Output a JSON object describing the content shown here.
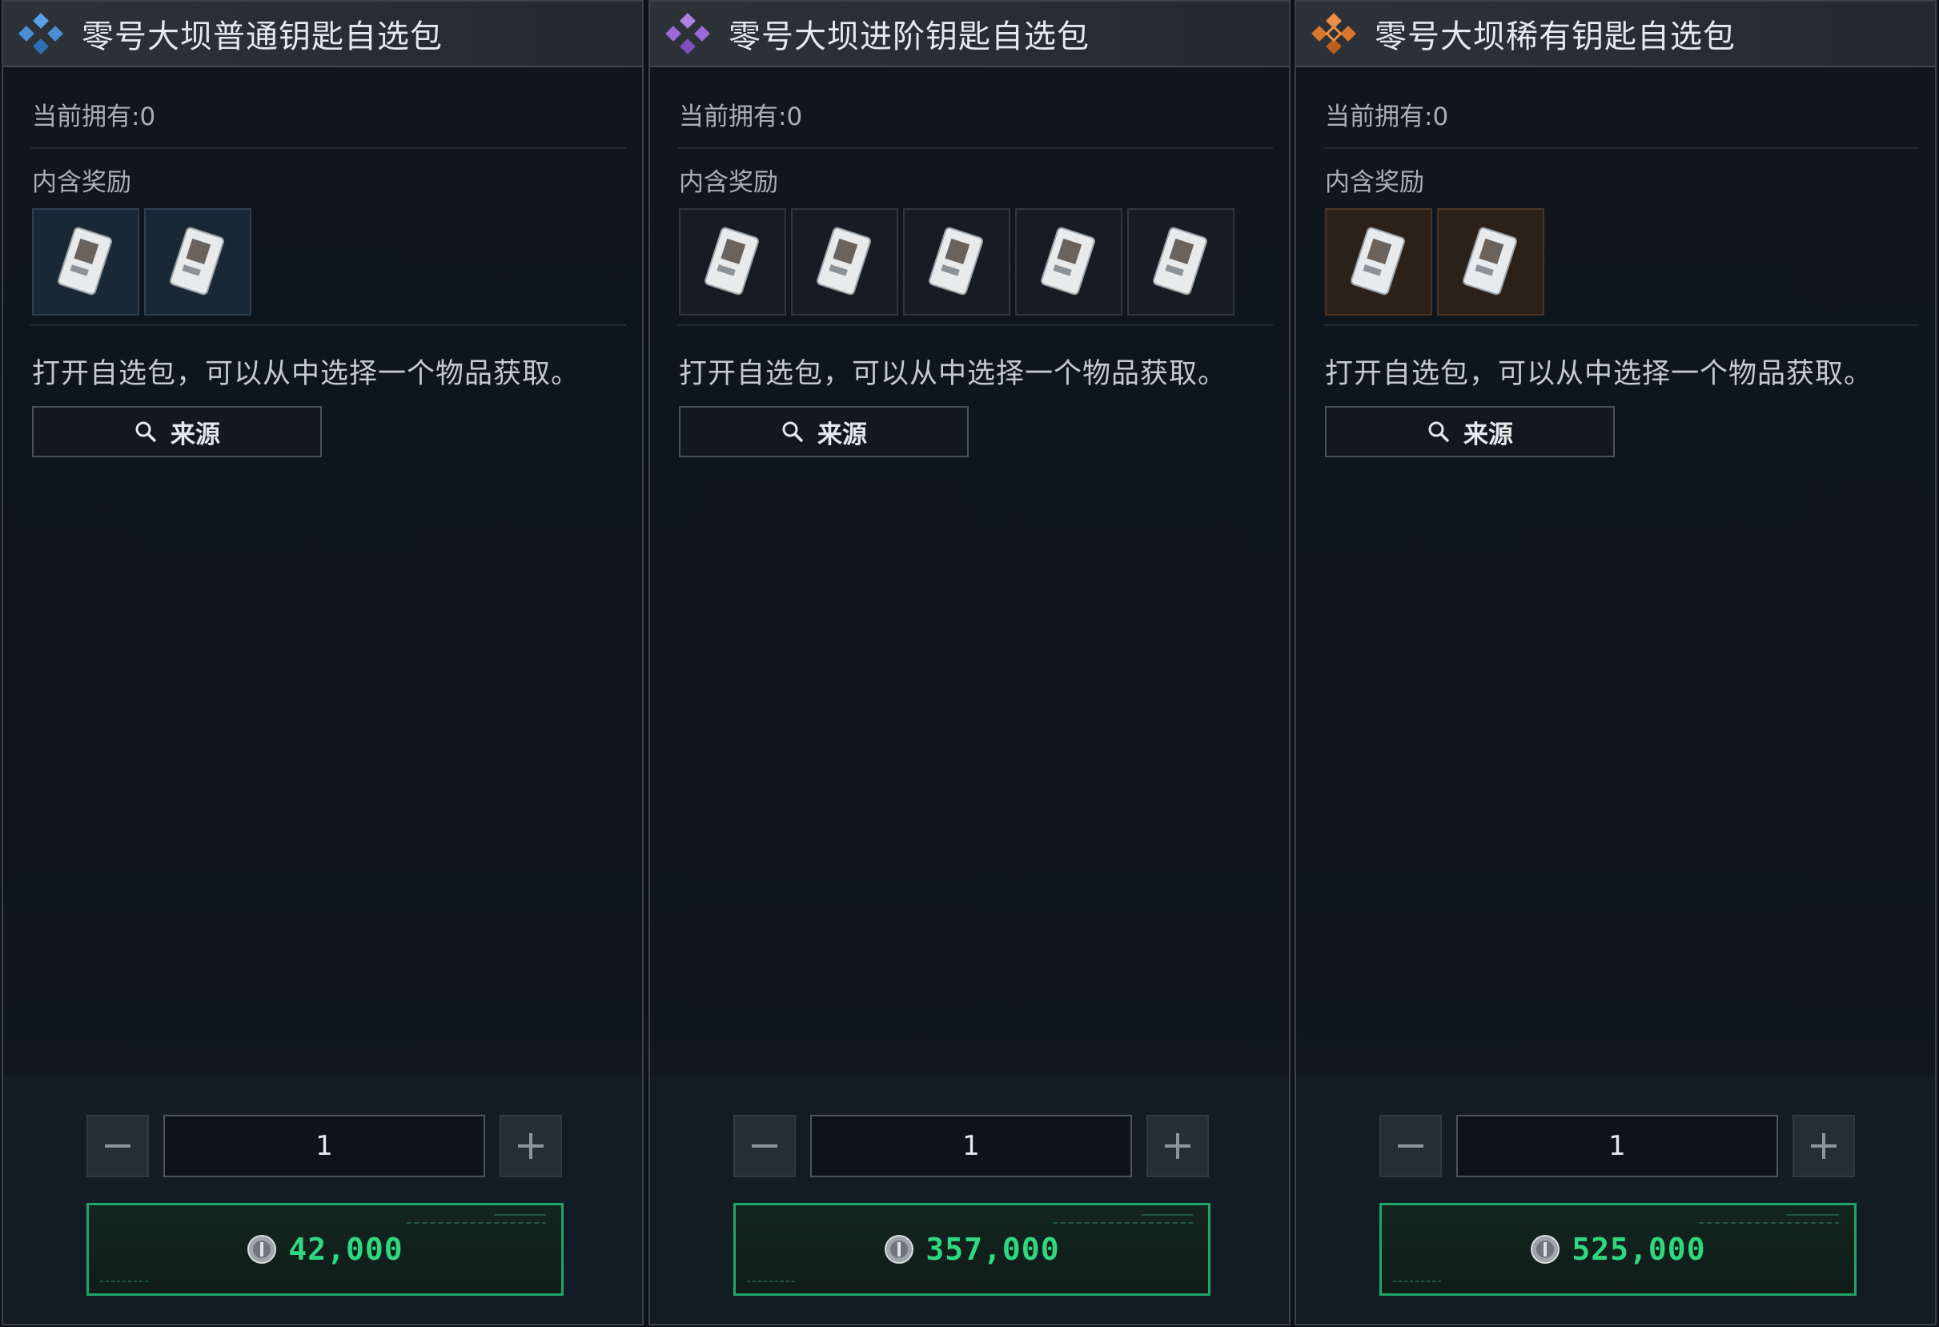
{
  "panels": [
    {
      "title": "零号大坝普通钥匙自选包",
      "rarity_color": "#4a8fd6",
      "owned": "当前拥有:0",
      "rewards_label": "内含奖励",
      "reward_count": 2,
      "description": "打开自选包，可以从中选择一个物品获取。",
      "source_label": "来源",
      "quantity": "1",
      "price": "42,000"
    },
    {
      "title": "零号大坝进阶钥匙自选包",
      "rarity_color": "#9a6ad6",
      "owned": "当前拥有:0",
      "rewards_label": "内含奖励",
      "reward_count": 5,
      "description": "打开自选包，可以从中选择一个物品获取。",
      "source_label": "来源",
      "quantity": "1",
      "price": "357,000"
    },
    {
      "title": "零号大坝稀有钥匙自选包",
      "rarity_color": "#d9782e",
      "owned": "当前拥有:0",
      "rewards_label": "内含奖励",
      "reward_count": 2,
      "description": "打开自选包，可以从中选择一个物品获取。",
      "source_label": "来源",
      "quantity": "1",
      "price": "525,000"
    }
  ],
  "colors": {
    "price_green": "#2fd880",
    "buy_border": "#1fa56a"
  }
}
